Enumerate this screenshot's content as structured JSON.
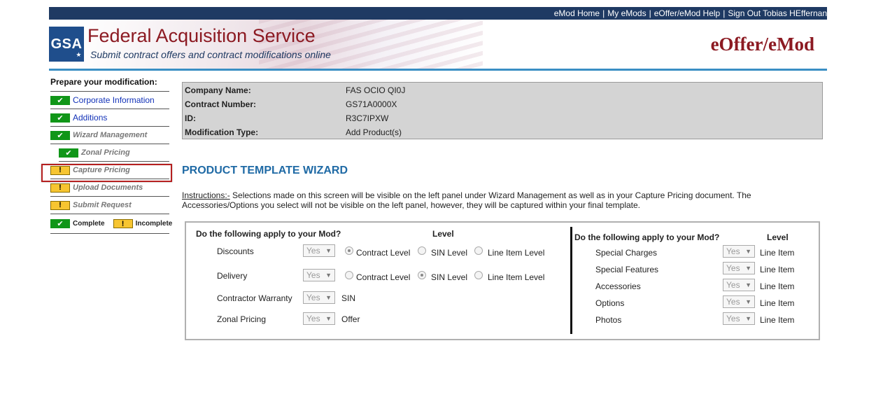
{
  "topnav": {
    "links": [
      "eMod Home",
      "My eMods",
      "eOffer/eMod Help",
      "Sign Out Tobias HEffernan"
    ],
    "separator": "|"
  },
  "banner": {
    "logo_text": "GSA",
    "title": "Federal Acquisition Service",
    "subtitle": "Submit contract offers and contract modifications online",
    "brand": "eOffer/eMod",
    "colors": {
      "navy": "#1f3a63",
      "brand_red": "#8c1a22",
      "accent_blue": "#3a8fc4"
    }
  },
  "sidebar": {
    "title": "Prepare your modification:",
    "items": [
      {
        "label": "Corporate Information",
        "status": "complete",
        "icon": "check-icon",
        "sub": false
      },
      {
        "label": "Additions",
        "status": "complete",
        "icon": "check-icon",
        "sub": false
      },
      {
        "label": "Wizard Management",
        "status": "complete",
        "icon": "check-icon",
        "sub": false
      },
      {
        "label": "Zonal Pricing",
        "status": "complete",
        "icon": "check-icon",
        "sub": true
      },
      {
        "label": "Capture Pricing",
        "status": "incomplete",
        "icon": "exclamation-icon",
        "sub": false
      },
      {
        "label": "Upload Documents",
        "status": "incomplete",
        "icon": "exclamation-icon",
        "sub": false
      },
      {
        "label": "Submit Request",
        "status": "incomplete",
        "icon": "exclamation-icon",
        "sub": false
      }
    ],
    "legend": {
      "complete": "Complete",
      "incomplete": "Incomplete"
    },
    "check_glyph": "✔",
    "warn_glyph": "!"
  },
  "info": {
    "rows": [
      {
        "label": "Company Name:",
        "value": "FAS OCIO QI0J"
      },
      {
        "label": "Contract Number:",
        "value": "GS71A0000X"
      },
      {
        "label": "ID:",
        "value": "R3C7IPXW"
      },
      {
        "label": "Modification Type:",
        "value": "Add Product(s)"
      }
    ]
  },
  "wizard": {
    "title": "PRODUCT TEMPLATE WIZARD",
    "instructions_label": "Instructions:-",
    "instructions_text": " Selections made on this screen will be visible on the left panel under Wizard Management as well as in your Capture Pricing document. The Accessories/Options you select will not be visible on the left panel, however, they will be captured within your final template."
  },
  "mod_left": {
    "question": "Do the following apply to your Mod?",
    "level_header": "Level",
    "rows": [
      {
        "label": "Discounts",
        "select": "Yes",
        "radios": [
          {
            "label": "Contract Level",
            "checked": true
          },
          {
            "label": "SIN Level",
            "checked": false
          },
          {
            "label": "Line Item Level",
            "checked": false
          }
        ]
      },
      {
        "label": "Delivery",
        "select": "Yes",
        "radios": [
          {
            "label": "Contract Level",
            "checked": false
          },
          {
            "label": "SIN Level",
            "checked": true
          },
          {
            "label": "Line Item Level",
            "checked": false
          }
        ]
      },
      {
        "label": "Contractor Warranty",
        "select": "Yes",
        "level": "SIN"
      },
      {
        "label": "Zonal Pricing",
        "select": "Yes",
        "level": "Offer"
      }
    ]
  },
  "mod_right": {
    "question": "Do the following apply to your Mod?",
    "level_header": "Level",
    "rows": [
      {
        "label": "Special Charges",
        "select": "Yes",
        "level": "Line Item"
      },
      {
        "label": "Special Features",
        "select": "Yes",
        "level": "Line Item"
      },
      {
        "label": "Accessories",
        "select": "Yes",
        "level": "Line Item"
      },
      {
        "label": "Options",
        "select": "Yes",
        "level": "Line Item"
      },
      {
        "label": "Photos",
        "select": "Yes",
        "level": "Line Item"
      }
    ]
  }
}
